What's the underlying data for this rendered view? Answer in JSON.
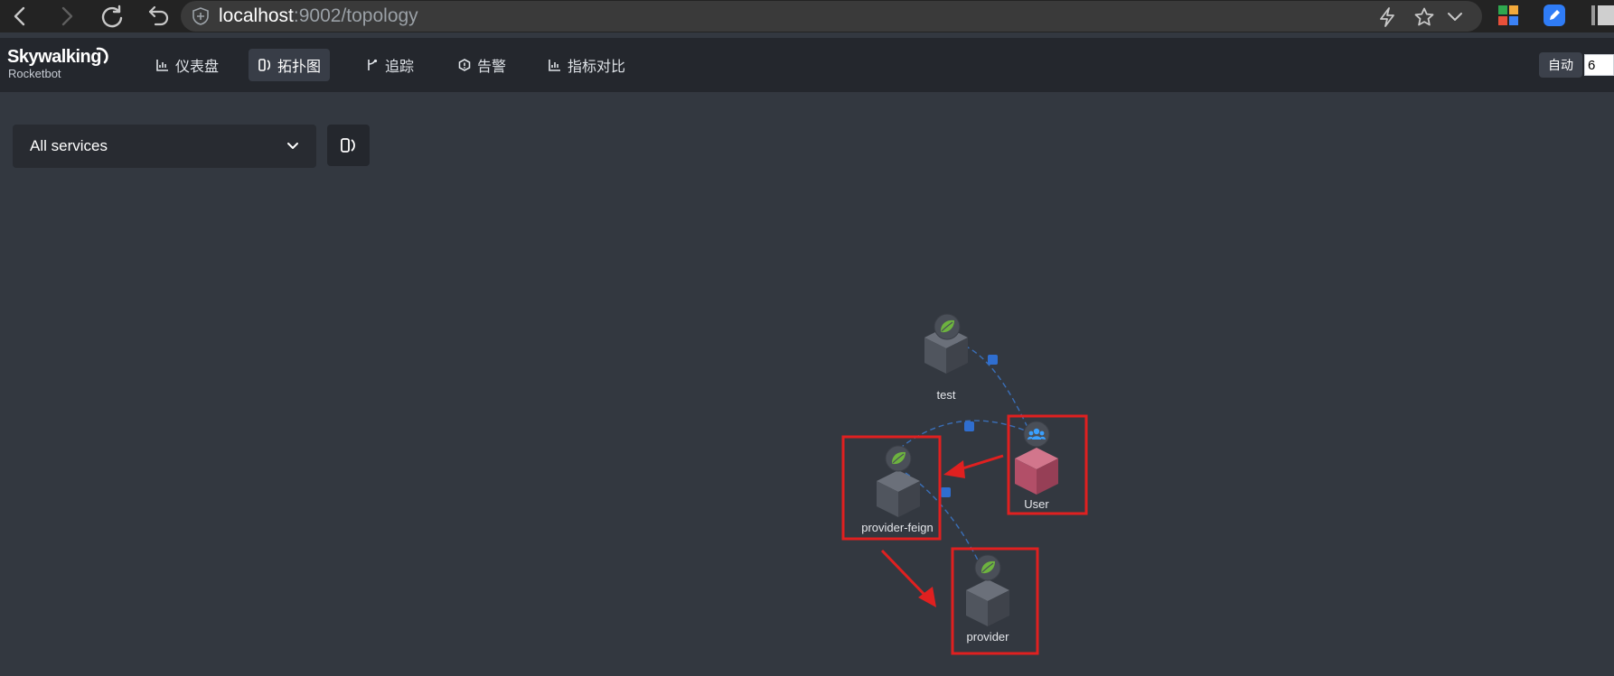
{
  "browser": {
    "url_host": "localhost",
    "url_rest": ":9002/topology",
    "icons": [
      "back-icon",
      "forward-icon",
      "reload-icon",
      "undo-icon",
      "shield-icon",
      "lightning-icon",
      "star-icon",
      "chevron-down-icon"
    ]
  },
  "app": {
    "logo_main": "Skywalking",
    "logo_sub": "Rocketbot",
    "nav": [
      {
        "label": "仪表盘",
        "icon": "chart-icon"
      },
      {
        "label": "拓扑图",
        "icon": "topology-icon",
        "active": true
      },
      {
        "label": "追踪",
        "icon": "trace-icon"
      },
      {
        "label": "告警",
        "icon": "alarm-icon"
      },
      {
        "label": "指标对比",
        "icon": "chart-icon"
      }
    ],
    "auto_label": "自动",
    "interval_value": "6"
  },
  "toolbar": {
    "service_select_value": "All services"
  },
  "topology": {
    "nodes": [
      {
        "id": "test",
        "label": "test",
        "type": "spring-boot",
        "cube_color": "#5c616b"
      },
      {
        "id": "user",
        "label": "User",
        "type": "user",
        "cube_color": "#c25b74"
      },
      {
        "id": "provider-feign",
        "label": "provider-feign",
        "type": "spring-boot",
        "cube_color": "#5c616b"
      },
      {
        "id": "provider",
        "label": "provider",
        "type": "spring-boot",
        "cube_color": "#5c616b"
      }
    ],
    "edges": [
      {
        "from": "test",
        "to": "user"
      },
      {
        "from": "user",
        "to": "provider-feign"
      },
      {
        "from": "provider-feign",
        "to": "provider"
      }
    ],
    "colors": {
      "edge": "#3a6fb8",
      "highlight_box": "#e02020",
      "spring_leaf": "#6db33f",
      "user_icon": "#3aa0ff"
    }
  }
}
